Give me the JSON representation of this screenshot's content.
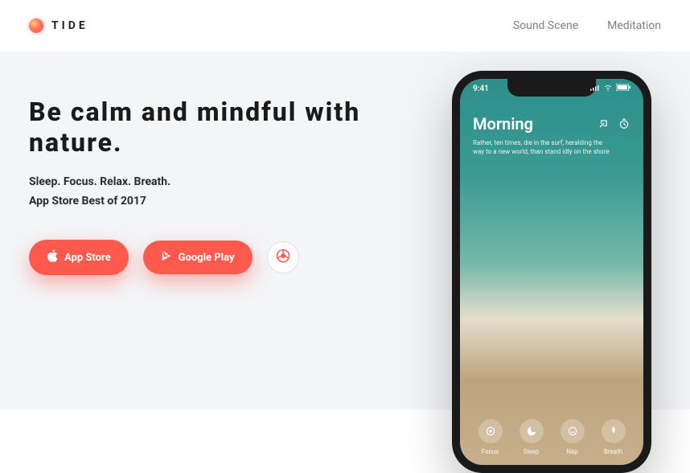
{
  "brand": {
    "name": "TIDE"
  },
  "nav": {
    "sound_scene": "Sound Scene",
    "meditation": "Meditation"
  },
  "hero": {
    "headline": "Be calm and mindful with nature.",
    "sub1": "Sleep. Focus. Relax. Breath.",
    "sub2": "App Store Best of 2017",
    "cta_appstore": "App Store",
    "cta_googleplay": "Google Play"
  },
  "phone": {
    "time": "9:41",
    "title": "Morning",
    "subtitle": "Rather, ten times, die in the surf, heralding the way to a new world, than stand idly on the shore",
    "tabs": {
      "focus": "Focus",
      "sleep": "Sleep",
      "nap": "Nap",
      "breath": "Breath"
    }
  },
  "colors": {
    "accent": "#ff5a4d",
    "bg_hero": "#f4f5f7"
  }
}
